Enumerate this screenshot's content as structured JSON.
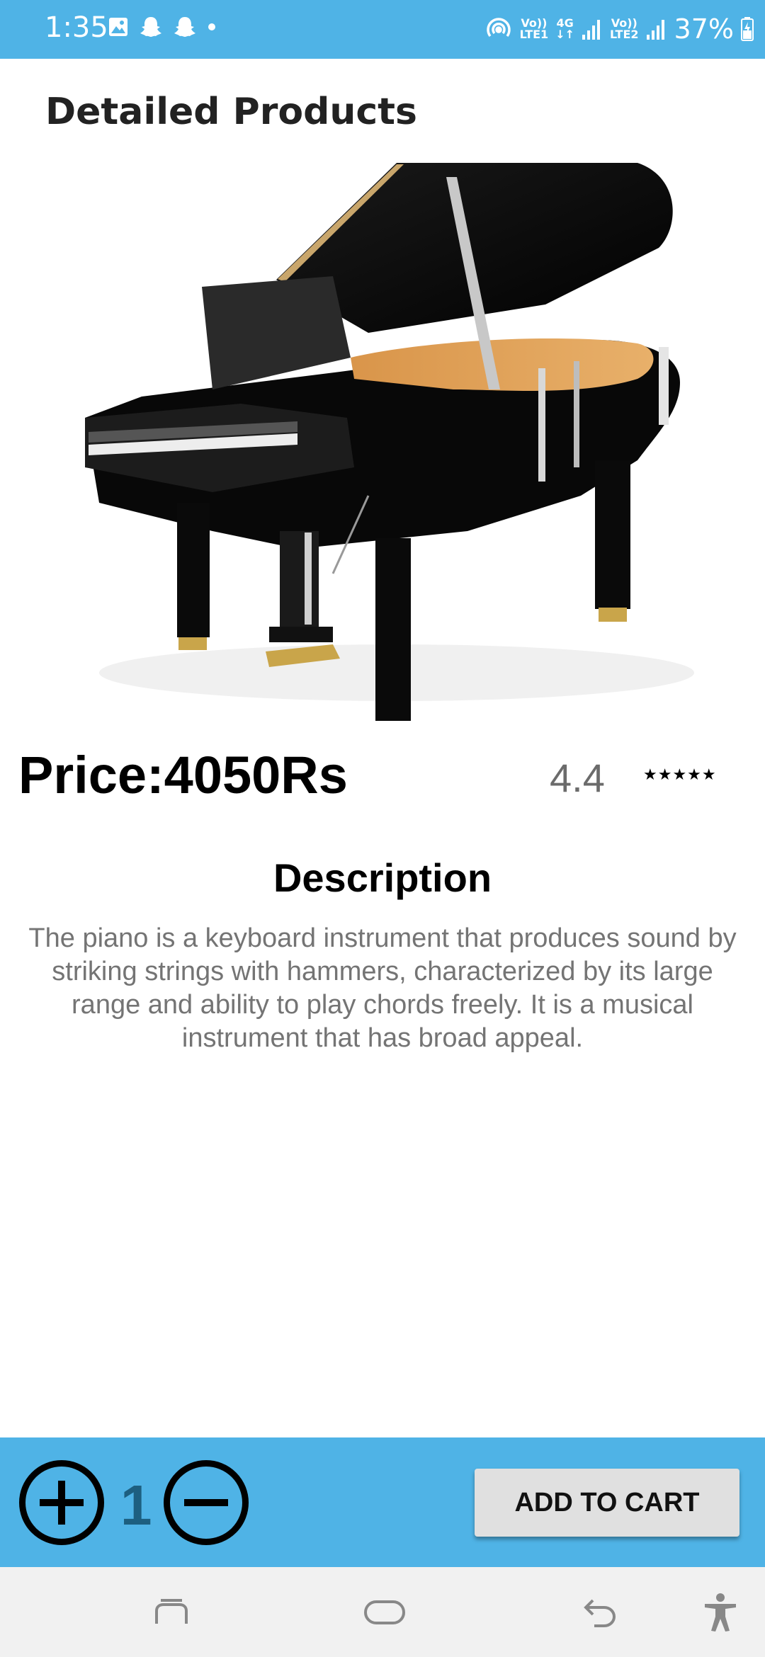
{
  "status_bar": {
    "time": "1:35",
    "network_1": {
      "top": "Vo))",
      "bottom": "LTE1"
    },
    "network_type": "4G",
    "network_2": {
      "top": "Vo))",
      "bottom": "LTE2"
    },
    "battery": "37%"
  },
  "header": {
    "title": "Detailed Products"
  },
  "product": {
    "image_icon": "grand-piano-image",
    "price": "Price:4050Rs",
    "rating": "4.4",
    "rating_stars": "★★★★★"
  },
  "description": {
    "title": "Description",
    "text": "The piano is a keyboard instrument that produces sound by striking strings with hammers, characterized by its large range and ability to play chords freely. It is a musical instrument that has broad appeal."
  },
  "cart": {
    "quantity": "1",
    "add_to_cart_label": "ADD TO CART"
  },
  "colors": {
    "accent": "#4fb3e6",
    "quantity_text": "#1d5f80",
    "button_bg": "#e0e0e0"
  }
}
